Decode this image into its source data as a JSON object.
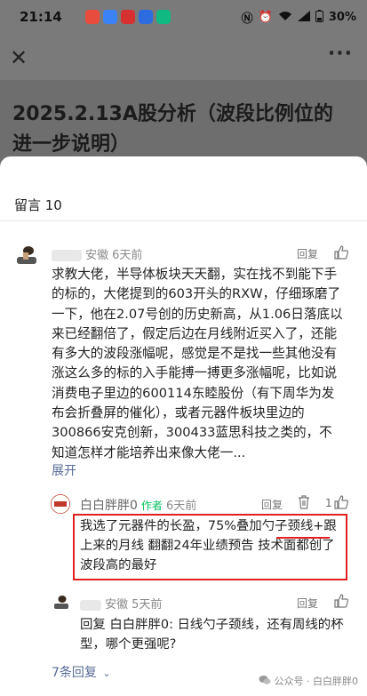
{
  "status": {
    "time": "21:14",
    "battery": "30%",
    "app_colors": [
      "#e74c3c",
      "#3b82f6",
      "#d63031",
      "#2d6cdf",
      "#10b981"
    ]
  },
  "article": {
    "title": "2025.2.13A股分析（波段比例位的进一步说明）"
  },
  "comments_header": "留言 10",
  "comment1": {
    "name": "安徽",
    "time": "6天前",
    "reply": "回复",
    "body": "求教大佬，半导体板块天天翻，实在找不到能下手的标的，大佬提到的603开头的RXW，仔细琢磨了一下，他在2.07号创的历史新高，从1.06日落底以来已经翻倍了，假定后边在月线附近买入了，还能有多大的波段涨幅呢，感觉是不是找一些其他没有涨这么多的标的入手能搏一搏更多涨幅呢，比如说消费电子里边的600114东睦股份（有下周华为发布会折叠屏的催化），或者元器件板块里边的300866安克创新，300433蓝思科技之类的，不知道怎样才能培养出来像大佬一...",
    "expand": "展开"
  },
  "reply1": {
    "name": "白白胖胖0",
    "author_tag": "作者",
    "time": "6天前",
    "reply": "回复",
    "likes": "1",
    "body": "我选了元器件的长盈，75%叠加勺子颈线+跟上来的月线 翻翻24年业绩预告 技术面都创了波段高的最好"
  },
  "reply2": {
    "name": "安徽",
    "time": "5天前",
    "reply": "回复",
    "body": "回复 白白胖胖0: 日线勺子颈线，还有周线的杯型，哪个更强呢?"
  },
  "more_replies": "7条回复",
  "watermark": "公众号 · 白白胖胖0"
}
